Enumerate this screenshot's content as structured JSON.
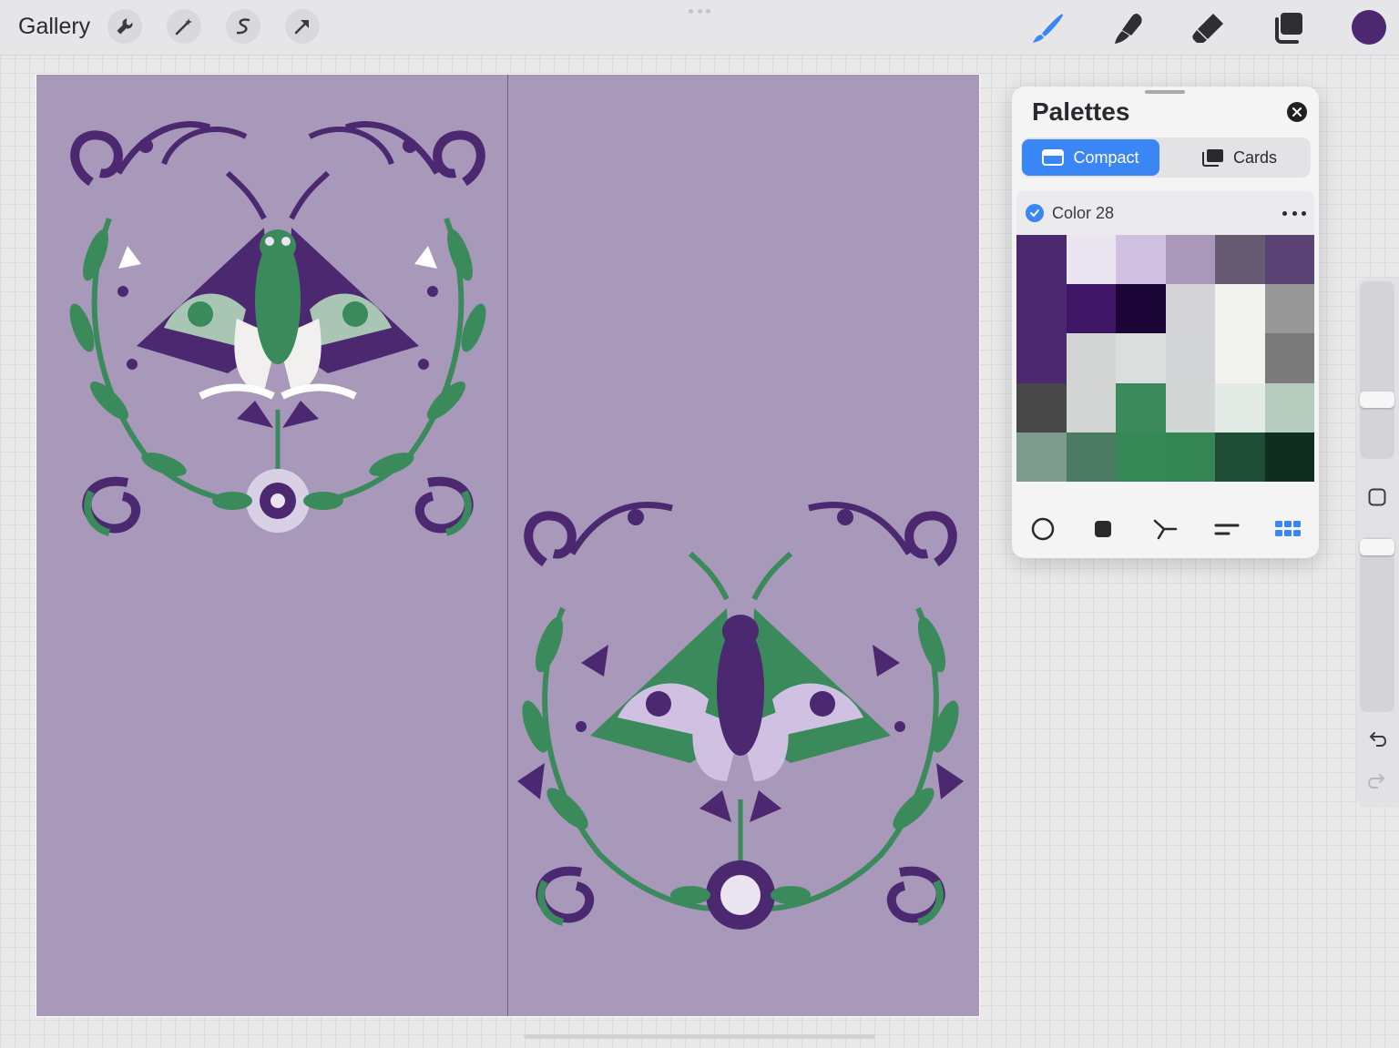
{
  "topbar": {
    "gallery_label": "Gallery",
    "tools": [
      "wrench-icon",
      "magic-wand-icon",
      "selection-icon",
      "transform-arrow-icon"
    ],
    "right_tools": [
      "brush-icon",
      "smudge-icon",
      "eraser-icon",
      "layers-icon"
    ],
    "current_color": "#4b2870"
  },
  "palettes": {
    "title": "Palettes",
    "tabs": [
      {
        "label": "Compact",
        "active": true
      },
      {
        "label": "Cards",
        "active": false
      }
    ],
    "palette_name": "Color 28",
    "accent": "#3a86f4",
    "swatches": [
      "#4b2870",
      "#ebe4f1",
      "#d0c1e3",
      "#a998ba",
      "#665b73",
      "#5b4275",
      "#3f1566",
      "#1c0638",
      "#d4d4d6",
      "#f2f3ef",
      "#979797",
      "#d3d4d4",
      "#dcdedd",
      "#d3d4d6",
      "#f2f3ef",
      "#7b7b7b",
      "#474747",
      "#d3d5d4",
      "#3a8a5c",
      "#d2d7d5",
      "#e2ebe5",
      "#b6ccbe",
      "#7d9c8e",
      "#4c7b63",
      "#348957",
      "#338653",
      "#1e4c35",
      "#0f2e1f"
    ],
    "bottom_tools": [
      "disc-icon",
      "classic-square-icon",
      "harmony-icon",
      "value-sliders-icon",
      "palette-grid-icon"
    ]
  },
  "canvas": {
    "background": "#a898ba"
  }
}
